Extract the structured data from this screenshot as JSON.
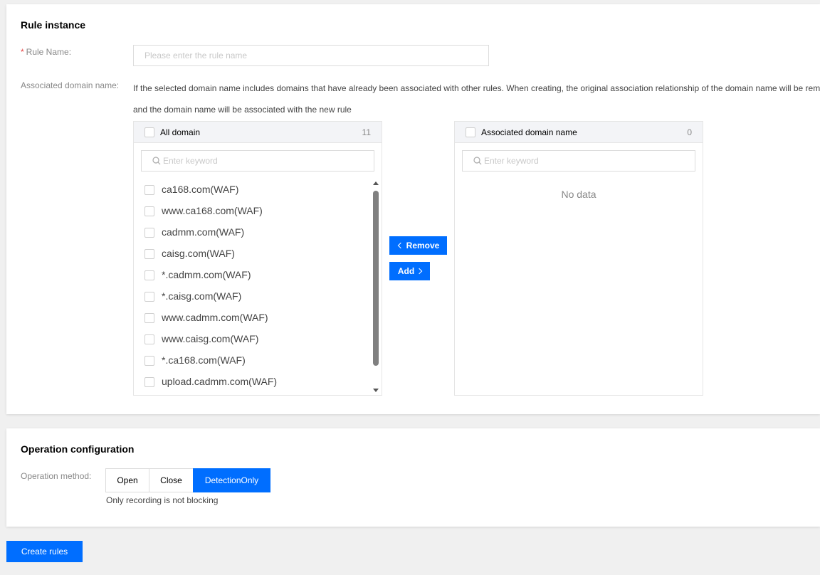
{
  "rule_instance": {
    "section_title": "Rule instance",
    "rule_name_required": "*",
    "rule_name_label": "Rule Name:",
    "rule_name_value": "",
    "rule_name_placeholder": "Please enter the rule name",
    "associated_label": "Associated domain name:",
    "hint_line1": "If the selected domain name includes domains that have already been associated with other rules. When creating, the original association relationship of the domain name will be rem",
    "hint_line2": "and the domain name will be associated with the new rule"
  },
  "left_panel": {
    "title": "All domain",
    "count": "11",
    "search_placeholder": "Enter keyword",
    "items": [
      {
        "label": "ca168.com(WAF)"
      },
      {
        "label": "www.ca168.com(WAF)"
      },
      {
        "label": "cadmm.com(WAF)"
      },
      {
        "label": "caisg.com(WAF)"
      },
      {
        "label": "*.cadmm.com(WAF)"
      },
      {
        "label": "*.caisg.com(WAF)"
      },
      {
        "label": "www.cadmm.com(WAF)"
      },
      {
        "label": "www.caisg.com(WAF)"
      },
      {
        "label": "*.ca168.com(WAF)"
      },
      {
        "label": "upload.cadmm.com(WAF)"
      }
    ]
  },
  "right_panel": {
    "title": "Associated domain name",
    "count": "0",
    "search_placeholder": "Enter keyword",
    "empty_text": "No data"
  },
  "transfer": {
    "remove_label": "Remove",
    "add_label": "Add"
  },
  "operation": {
    "section_title": "Operation configuration",
    "method_label": "Operation method:",
    "options": [
      "Open",
      "Close",
      "DetectionOnly"
    ],
    "selected": "DetectionOnly",
    "hint": "Only recording is not blocking"
  },
  "footer": {
    "create_label": "Create rules"
  },
  "colors": {
    "accent": "#006eff",
    "required": "#e54545"
  },
  "icons": {
    "search": "search-icon",
    "chevron_left": "chevron-left-icon",
    "chevron_right": "chevron-right-icon"
  }
}
